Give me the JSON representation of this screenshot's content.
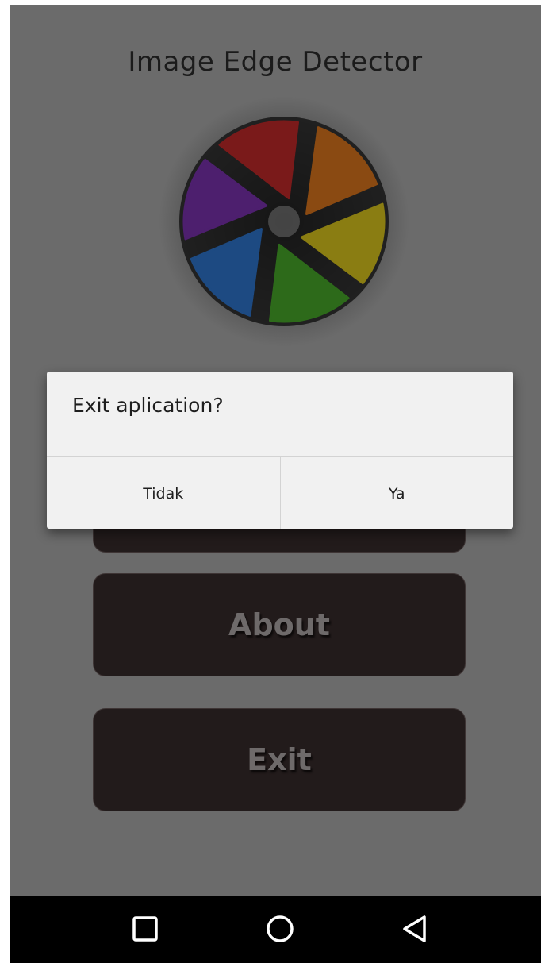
{
  "app": {
    "title": "Image Edge Detector"
  },
  "menu": {
    "about_label": "About",
    "exit_label": "Exit"
  },
  "dialog": {
    "message": "Exit aplication?",
    "negative_label": "Tidak",
    "positive_label": "Ya"
  },
  "logo": {
    "name": "aperture-logo",
    "colors": [
      "#7a1a1a",
      "#8a4a12",
      "#8a7d12",
      "#2d6a1a",
      "#1d4a82",
      "#4d1f6e"
    ]
  },
  "navbar": {
    "icons": [
      "recents-icon",
      "home-icon",
      "back-icon"
    ]
  }
}
